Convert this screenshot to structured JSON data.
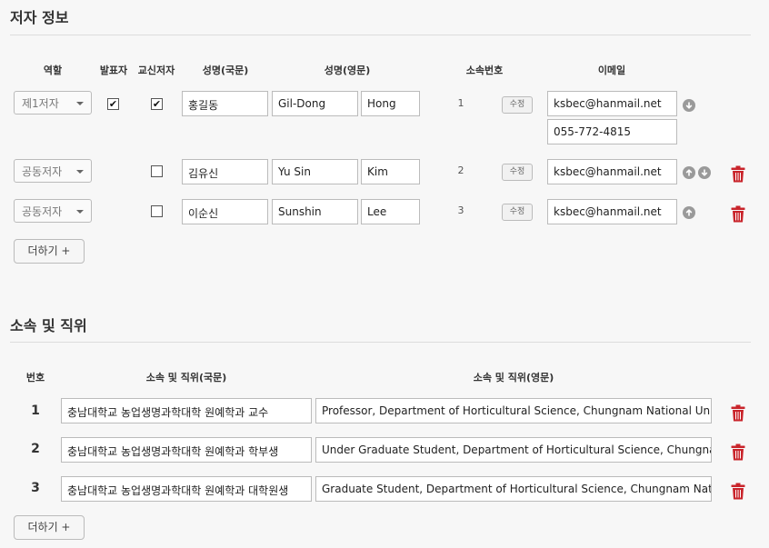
{
  "authors_section": {
    "title": "저자 정보",
    "headers": {
      "role": "역할",
      "presenter": "발표자",
      "corresponding": "교신저자",
      "name_kr": "성명(국문)",
      "name_en": "성명(영문)",
      "affiliation_no": "소속번호",
      "email": "이메일"
    },
    "rows": [
      {
        "role": "제1저자",
        "presenter_mark": "✔",
        "corresponding_mark": "✔",
        "name_kr": "홍길동",
        "first_en": "Gil-Dong",
        "last_en": "Hong",
        "aff_no": "1",
        "edit": "수정",
        "email": "ksbec@hanmail.net",
        "phone": "055-772-4815"
      },
      {
        "role": "공동저자",
        "presenter_mark": "",
        "corresponding_mark": "",
        "name_kr": "김유신",
        "first_en": "Yu Sin",
        "last_en": "Kim",
        "aff_no": "2",
        "edit": "수정",
        "email": "ksbec@hanmail.net"
      },
      {
        "role": "공동저자",
        "presenter_mark": "",
        "corresponding_mark": "",
        "name_kr": "이순신",
        "first_en": "Sunshin",
        "last_en": "Lee",
        "aff_no": "3",
        "edit": "수정",
        "email": "ksbec@hanmail.net"
      }
    ],
    "add_label": "더하기 +"
  },
  "affiliation_section": {
    "title": "소속 및 직위",
    "headers": {
      "number": "번호",
      "kr": "소속 및 직위(국문)",
      "en": "소속 및 직위(영문)"
    },
    "rows": [
      {
        "no": "1",
        "kr": "충남대학교 농업생명과학대학 원예학과 교수",
        "en": "Professor, Department of Horticultural Science, Chungnam National University"
      },
      {
        "no": "2",
        "kr": "충남대학교 농업생명과학대학 원예학과 학부생",
        "en": "Under Graduate Student, Department of Horticultural Science, Chungnam National University"
      },
      {
        "no": "3",
        "kr": "충남대학교 농업생명과학대학 원예학과 대학원생",
        "en": "Graduate Student, Department of Horticultural Science, Chungnam National University"
      }
    ],
    "add_label": "더하기 +"
  },
  "icons": {
    "up": "arrow-up-circle-icon",
    "down": "arrow-down-circle-icon",
    "delete": "trash-icon"
  },
  "colors": {
    "delete_red": "#c9242b",
    "arrow_gray": "#9a9a9a"
  }
}
